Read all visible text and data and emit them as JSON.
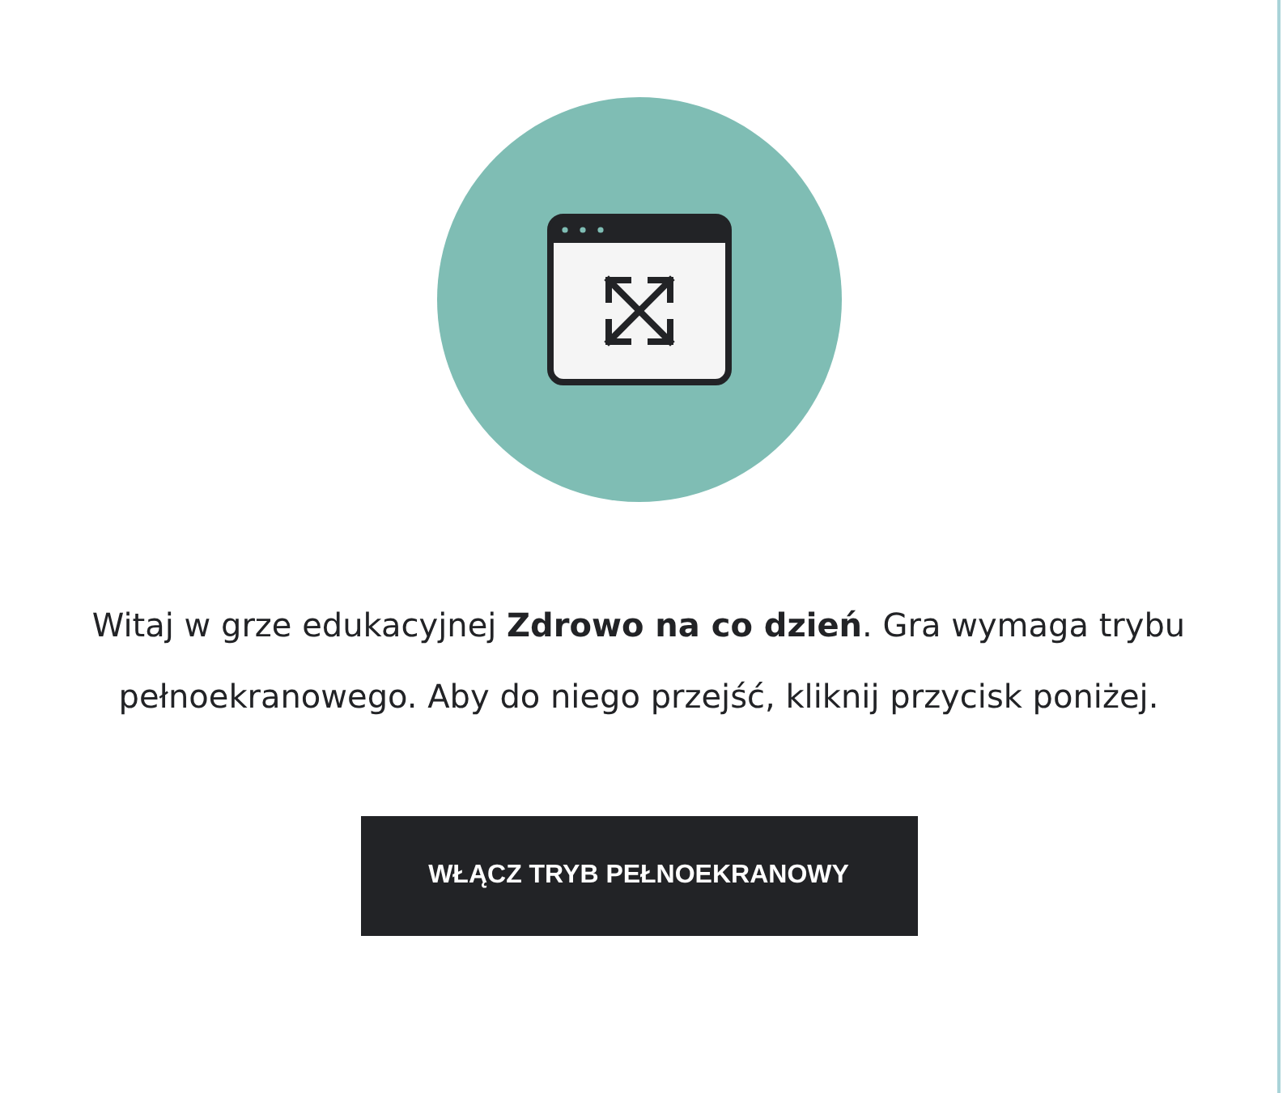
{
  "intro": {
    "text": "Witaj w grze edukacyjnej **Zdrowo na co dzień**. Gra wymaga trybu pełnoekranowego. Aby do niego przejść, kliknij przycisk poniżej."
  },
  "button": {
    "label": "WŁĄCZ TRYB PEŁNOEKRANOWY"
  }
}
